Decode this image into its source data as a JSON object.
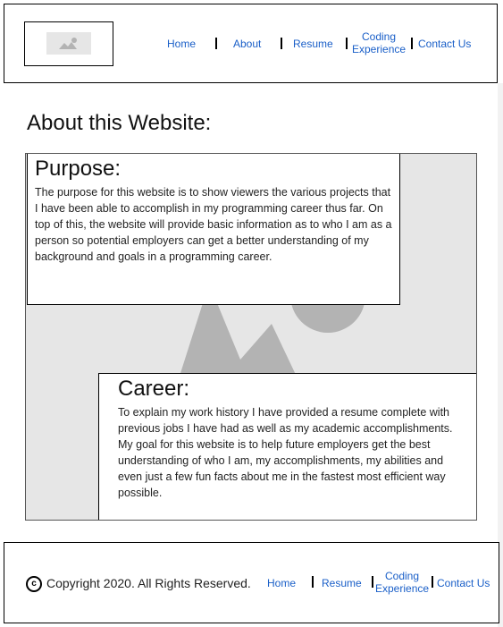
{
  "nav": {
    "home": "Home",
    "about": "About",
    "resume": "Resume",
    "coding_line1": "Coding",
    "coding_line2": "Experience",
    "contact": "Contact Us"
  },
  "main": {
    "title": "About this Website:",
    "purpose": {
      "heading": "Purpose:",
      "body": "The purpose for this website is to show viewers the various projects that I have been able to accomplish in my programming career thus far. On top of this, the website will provide basic information as to who I am as a person so potential employers can get a better understanding of my background and goals in a programming career."
    },
    "career": {
      "heading": "Career:",
      "body": "To explain my work history I have provided a resume complete with previous jobs I have had as well as my academic accomplishments. My goal for this website is to help future employers get the best understanding of who I am, my accomplishments, my abilities and even just a few fun facts about me in the fastest most efficient way possible."
    }
  },
  "footer": {
    "copyright_symbol": "c",
    "copyright": "Copyright 2020. All Rights Reserved.",
    "home": "Home",
    "resume": "Resume",
    "coding_line1": "Coding",
    "coding_line2": "Experience",
    "contact": "Contact Us"
  },
  "icons": {
    "logo": "image-placeholder-icon",
    "hero": "image-placeholder-icon",
    "copyright": "copyright-icon"
  },
  "colors": {
    "link": "#1a5fc8",
    "placeholder": "#e6e6e6",
    "placeholder_shape": "#b3b3b3"
  }
}
